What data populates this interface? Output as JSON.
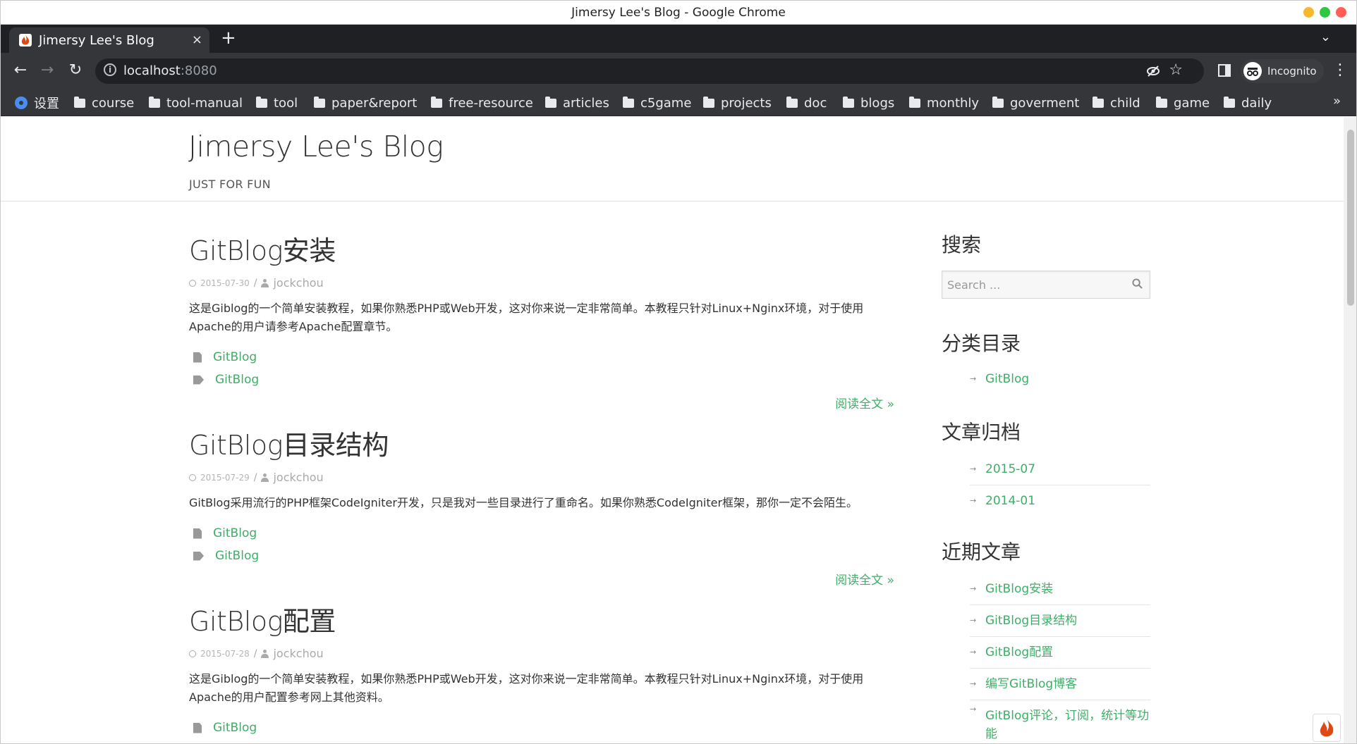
{
  "window": {
    "title": "Jimersy Lee's Blog - Google Chrome",
    "traffic_colors": [
      "#f5b82e",
      "#2bc840",
      "#ff5f57"
    ]
  },
  "tab": {
    "label": "Jimersy Lee's Blog",
    "close": "×",
    "new_tab": "+",
    "menu": "⌄"
  },
  "toolbar": {
    "back": "←",
    "forward": "→",
    "reload": "↻",
    "url_host": "localhost",
    "url_port": ":8080",
    "star": "☆",
    "profile": "Incognito",
    "menu": "⋮"
  },
  "bookmarks": {
    "items": [
      {
        "label": "设置",
        "icon": "gear-icon"
      },
      {
        "label": "course",
        "icon": "folder-icon"
      },
      {
        "label": "tool-manual",
        "icon": "folder-icon"
      },
      {
        "label": "tool",
        "icon": "folder-icon"
      },
      {
        "label": "paper&report",
        "icon": "folder-icon"
      },
      {
        "label": "free-resource",
        "icon": "folder-icon"
      },
      {
        "label": "articles",
        "icon": "folder-icon"
      },
      {
        "label": "c5game",
        "icon": "folder-icon"
      },
      {
        "label": "projects",
        "icon": "folder-icon"
      },
      {
        "label": "doc",
        "icon": "folder-icon"
      },
      {
        "label": "blogs",
        "icon": "folder-icon"
      },
      {
        "label": "monthly",
        "icon": "folder-icon"
      },
      {
        "label": "goverment",
        "icon": "folder-icon"
      },
      {
        "label": "child",
        "icon": "folder-icon"
      },
      {
        "label": "game",
        "icon": "folder-icon"
      },
      {
        "label": "daily",
        "icon": "folder-icon"
      }
    ],
    "more": "»"
  },
  "site": {
    "title": "Jimersy Lee's Blog",
    "description": "JUST FOR FUN"
  },
  "posts": [
    {
      "title": "GitBlog安装",
      "date": "2015-07-30",
      "sep": "/",
      "author": "jockchou",
      "excerpt": "这是Giblog的一个简单安装教程，如果你熟悉PHP或Web开发，这对你来说一定非常简单。本教程只针对Linux+Nginx环境，对于使用Apache的用户请参考Apache配置章节。",
      "category": "GitBlog",
      "tag": "GitBlog",
      "readmore": "阅读全文 »"
    },
    {
      "title": "GitBlog目录结构",
      "date": "2015-07-29",
      "sep": "/",
      "author": "jockchou",
      "excerpt": "GitBlog采用流行的PHP框架CodeIgniter开发，只是我对一些目录进行了重命名。如果你熟悉CodeIgniter框架，那你一定不会陌生。",
      "category": "GitBlog",
      "tag": "GitBlog",
      "readmore": "阅读全文 »"
    },
    {
      "title": "GitBlog配置",
      "date": "2015-07-28",
      "sep": "/",
      "author": "jockchou",
      "excerpt": "这是Giblog的一个简单安装教程，如果你熟悉PHP或Web开发，这对你来说一定非常简单。本教程只针对Linux+Nginx环境，对于使用Apache的用户配置参考网上其他资料。",
      "category": "GitBlog",
      "tag": "GitBlog",
      "readmore": ""
    }
  ],
  "sidebar": {
    "search_heading": "搜索",
    "search_placeholder": "Search ...",
    "categories_heading": "分类目录",
    "categories": [
      "GitBlog"
    ],
    "archives_heading": "文章归档",
    "archives": [
      "2015-07",
      "2014-01"
    ],
    "recent_heading": "近期文章",
    "recent": [
      "GitBlog安装",
      "GitBlog目录结构",
      "GitBlog配置",
      "编写GitBlog博客",
      "GitBlog评论，订阅，统计等功能"
    ]
  },
  "colors": {
    "link_green": "#3fae68",
    "chrome_dark": "#35363a"
  }
}
